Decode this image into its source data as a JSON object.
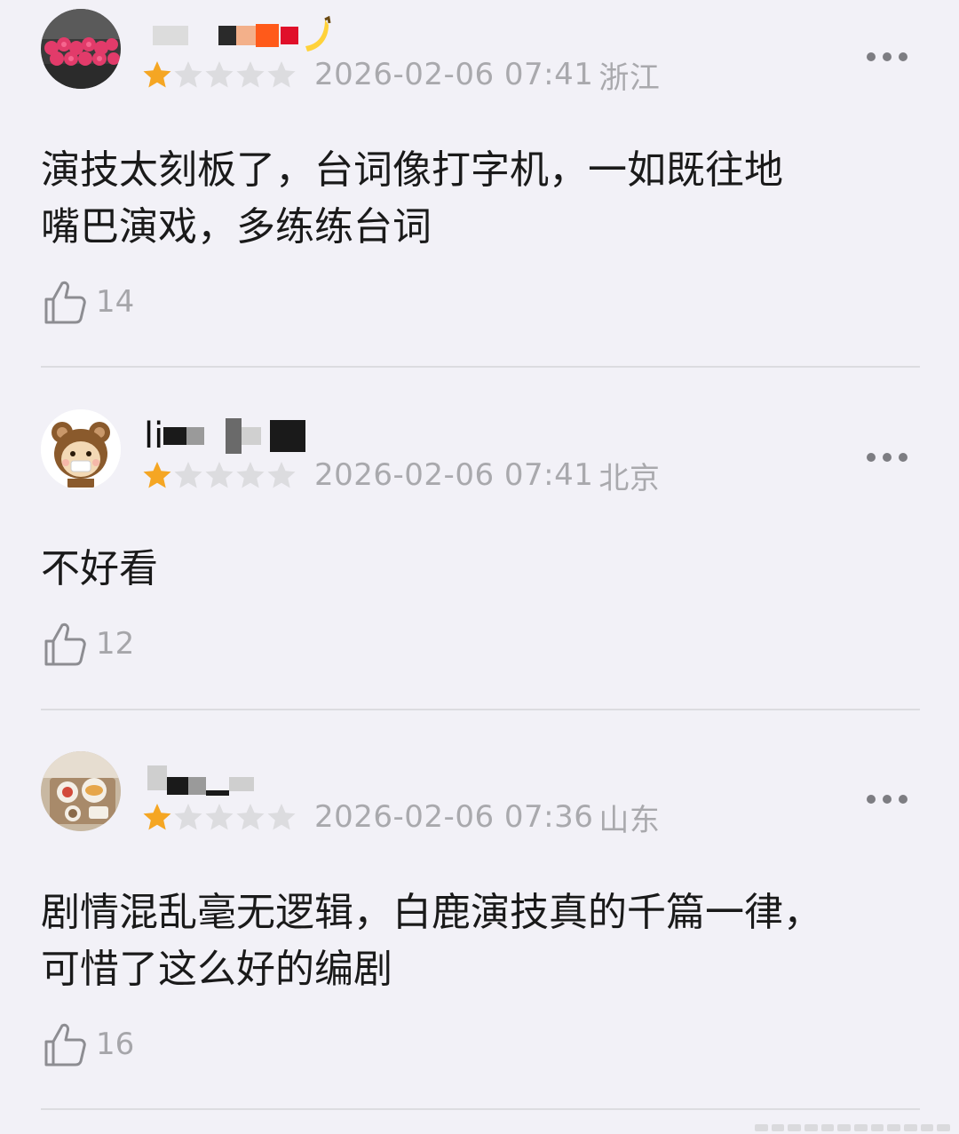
{
  "reviews": [
    {
      "username": "",
      "rating": 1,
      "max_rating": 5,
      "date": "2026-02-06 07:41",
      "location": "浙江",
      "content_lines": [
        "演技太刻板了，台词像打字机，一如既往地",
        "嘴巴演戏，多练练台词"
      ],
      "likes": "14",
      "avatar_icon": "roses-avatar"
    },
    {
      "username": "li",
      "rating": 1,
      "max_rating": 5,
      "date": "2026-02-06 07:41",
      "location": "北京",
      "content_lines": [
        "不好看"
      ],
      "likes": "12",
      "avatar_icon": "bear-avatar"
    },
    {
      "username": "",
      "rating": 1,
      "max_rating": 5,
      "date": "2026-02-06 07:36",
      "location": "山东",
      "content_lines": [
        "剧情混乱毫无逻辑，白鹿演技真的千篇一律，",
        "可惜了这么好的编剧"
      ],
      "likes": "16",
      "avatar_icon": "breakfast-avatar"
    }
  ],
  "colors": {
    "background": "#f2f1f7",
    "star_filled": "#f5a623",
    "star_empty": "#dcdcdf",
    "meta_text": "#a9a9ad",
    "body_text": "#1a1a1a",
    "divider": "#dcdce0"
  },
  "icons": {
    "more": "more-dots-icon",
    "like": "thumbs-up-icon",
    "star": "star-icon"
  }
}
